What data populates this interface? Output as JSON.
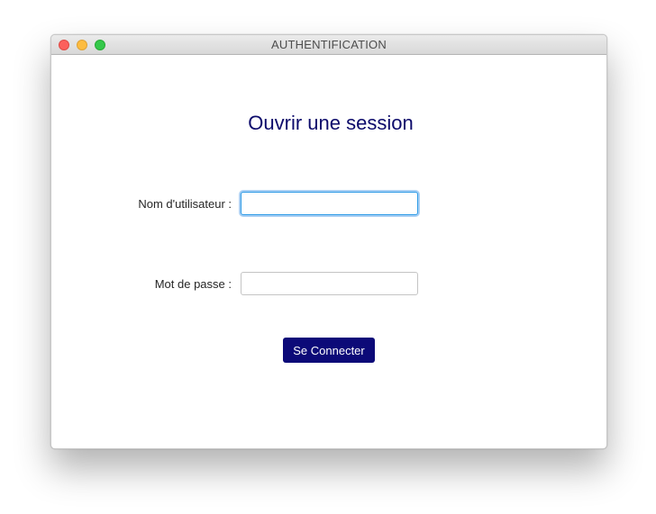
{
  "window": {
    "title": "AUTHENTIFICATION",
    "controls": [
      "close",
      "minimize",
      "maximize"
    ]
  },
  "form": {
    "heading": "Ouvrir une session",
    "username_label": "Nom d'utilisateur :",
    "username_value": "",
    "password_label": "Mot de passe :",
    "password_value": "",
    "submit_label": "Se Connecter"
  },
  "colors": {
    "heading": "#0c0a6b",
    "button_bg": "#0c0a78",
    "button_text": "#ffffff",
    "focus_ring": "#2c9be6"
  }
}
